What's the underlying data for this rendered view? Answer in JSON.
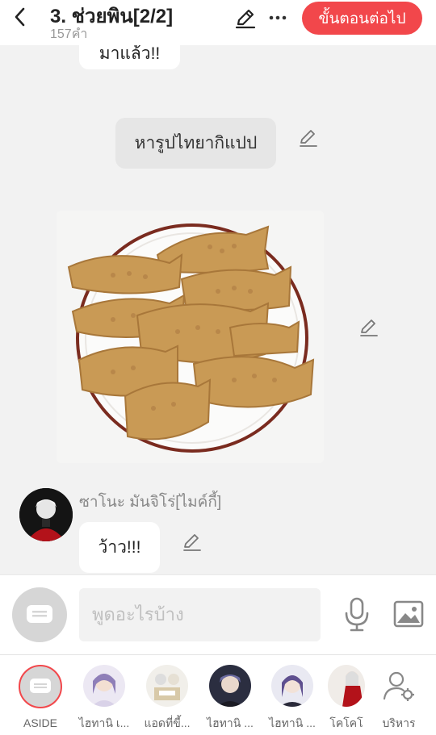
{
  "header": {
    "title": "3. ช่วยพิน[2/2]",
    "word_count": "157คำ",
    "next_label": "ขั้นตอนต่อไป"
  },
  "messages": {
    "top_partial": "มาแล้ว!!",
    "narration": "หารูปไทยากิแปป",
    "sender": "ซาโนะ  มันจิโร่[ไมค์กี้]",
    "reply": "ว้าว!!!"
  },
  "input": {
    "placeholder": "พูดอะไรบ้าง"
  },
  "characters": [
    {
      "name": "ASIDE"
    },
    {
      "name": "ไฮทานิ เ..."
    },
    {
      "name": "แอดที่ขี้..."
    },
    {
      "name": "ไฮทานิ ..."
    },
    {
      "name": "ไฮทานิ ..."
    },
    {
      "name": "โคโคโ"
    },
    {
      "name": "บริหาร"
    }
  ],
  "colors": {
    "accent": "#f2474b",
    "background": "#f2f2f2"
  }
}
